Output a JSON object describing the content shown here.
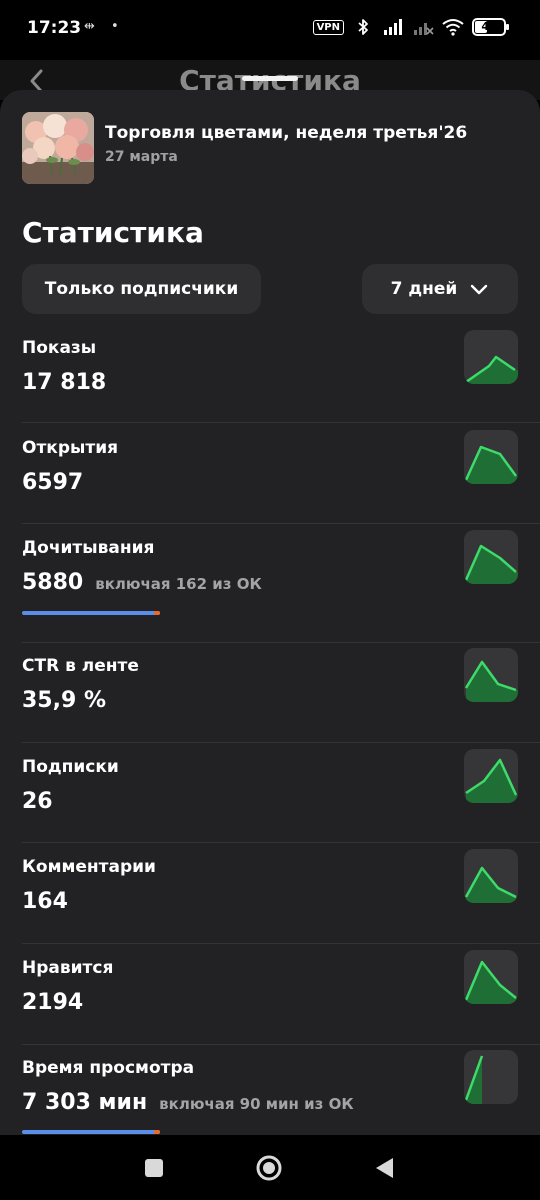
{
  "status_bar": {
    "time": "17:23",
    "left_icons": "⇹ •",
    "vpn": "VPN",
    "battery": "40"
  },
  "header": {
    "title": "Статистика"
  },
  "article": {
    "title": "Торговля цветами, неделя третья'26",
    "date": "27 марта"
  },
  "stats": {
    "title": "Статистика",
    "filter_audience": "Только подписчики",
    "filter_period": "7 дней"
  },
  "metrics": [
    {
      "label": "Показы",
      "value": "17 818",
      "extra": ""
    },
    {
      "label": "Открытия",
      "value": "6597",
      "extra": ""
    },
    {
      "label": "Дочитывания",
      "value": "5880",
      "extra": "включая 162 из ОК",
      "progress": 0.96
    },
    {
      "label": "CTR в ленте",
      "value": "35,9 %",
      "extra": ""
    },
    {
      "label": "Подписки",
      "value": "26",
      "extra": ""
    },
    {
      "label": "Комментарии",
      "value": "164",
      "extra": ""
    },
    {
      "label": "Нравится",
      "value": "2194",
      "extra": ""
    },
    {
      "label": "Время просмотра",
      "value": "7 303 мин",
      "extra": "включая 90 мин из ОК",
      "progress": 0.96
    }
  ],
  "colors": {
    "spark_fill": "#1f6e35",
    "spark_line": "#3ddc6a",
    "progress_main": "#5a8ee8",
    "progress_tail": "#e8692e",
    "sheet_bg": "#222224",
    "card_bg": "#2f2f31"
  },
  "icons": {
    "back": "chevron-left-icon",
    "period": "chevron-down-icon",
    "nav_recents": "square-icon",
    "nav_home": "circle-icon",
    "nav_back": "triangle-left-icon"
  }
}
